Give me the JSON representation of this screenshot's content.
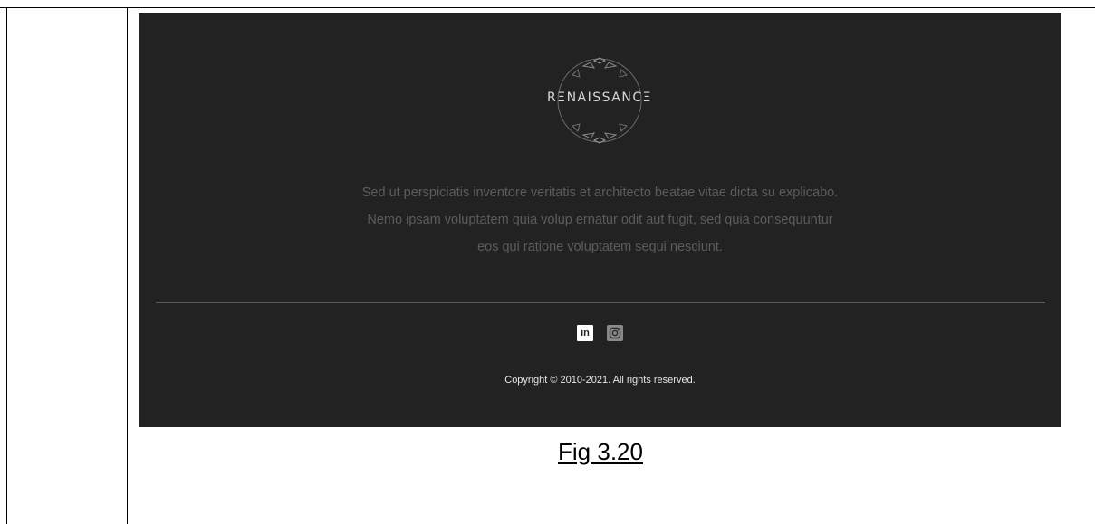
{
  "footer": {
    "logo_text": "RΞNAISSANCΞ",
    "logo_icon": "ornate-circle-icon",
    "description_lines": [
      "Sed ut perspiciatis inventore veritatis et architecto beatae vitae dicta su explicabo.",
      "Nemo ipsam voluptatem quia volup ernatur odit aut fugit, sed quia consequuntur",
      "eos qui ratione voluptatem sequi nesciunt."
    ],
    "social": [
      {
        "name": "linkedin-icon",
        "label": "in"
      },
      {
        "name": "instagram-icon",
        "label": ""
      }
    ],
    "copyright": "Copyright © 2010-2021. All rights reserved."
  },
  "caption": "Fig 3.20",
  "colors": {
    "footer_background": "#222222",
    "description_text": "#5c5c5c",
    "copyright_text": "#e6e6e6"
  }
}
